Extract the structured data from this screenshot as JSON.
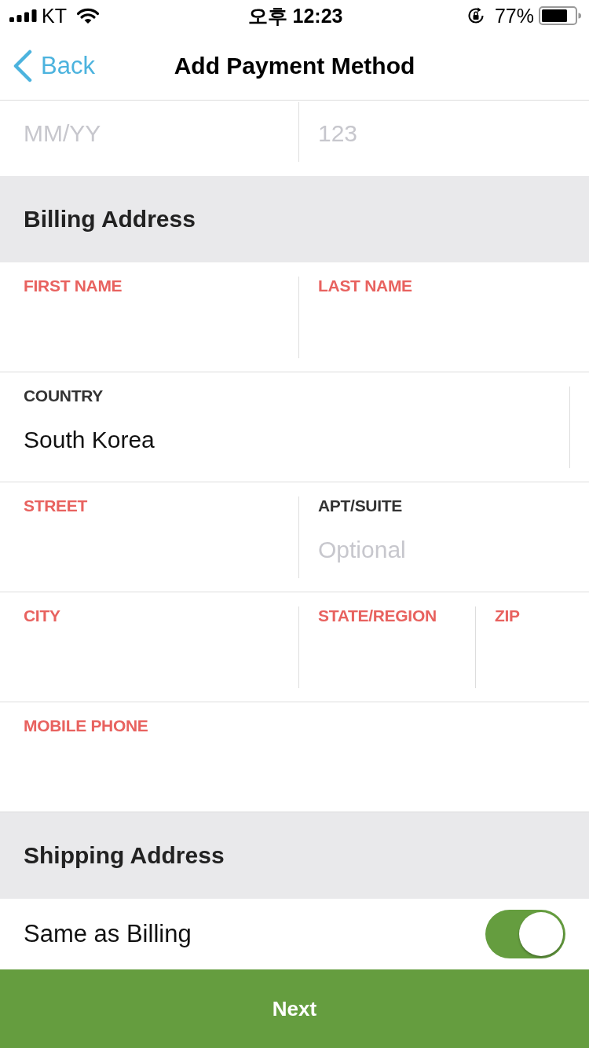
{
  "status_bar": {
    "carrier": "KT",
    "time": "오후 12:23",
    "battery": "77%"
  },
  "nav": {
    "back": "Back",
    "title": "Add Payment Method"
  },
  "card": {
    "fields": [
      {
        "placeholder": "MM/YY"
      },
      {
        "placeholder": "123"
      }
    ]
  },
  "billing": {
    "title": "Billing Address",
    "rows": [
      {
        "fields": [
          {
            "kind": "text",
            "label": "FIRST NAME",
            "error": true
          },
          {
            "kind": "text",
            "label": "LAST NAME",
            "error": true
          }
        ]
      },
      {
        "fields": [
          {
            "kind": "picker",
            "label": "COUNTRY",
            "error": false,
            "value": "South Korea"
          }
        ]
      },
      {
        "fields": [
          {
            "kind": "text",
            "label": "STREET",
            "error": true
          },
          {
            "kind": "text",
            "label": "APT/SUITE",
            "error": false,
            "placeholder": "Optional"
          }
        ]
      },
      {
        "fields": [
          {
            "kind": "text",
            "label": "CITY",
            "error": true
          },
          {
            "kind": "text",
            "label": "STATE/REGION",
            "error": true
          },
          {
            "kind": "text",
            "label": "ZIP",
            "error": true
          }
        ]
      },
      {
        "fields": [
          {
            "kind": "text",
            "label": "MOBILE PHONE",
            "error": true
          }
        ]
      }
    ]
  },
  "shipping": {
    "title": "Shipping Address",
    "same_as_billing": {
      "label": "Same as Billing",
      "on": true
    }
  },
  "next_button": "Next"
}
